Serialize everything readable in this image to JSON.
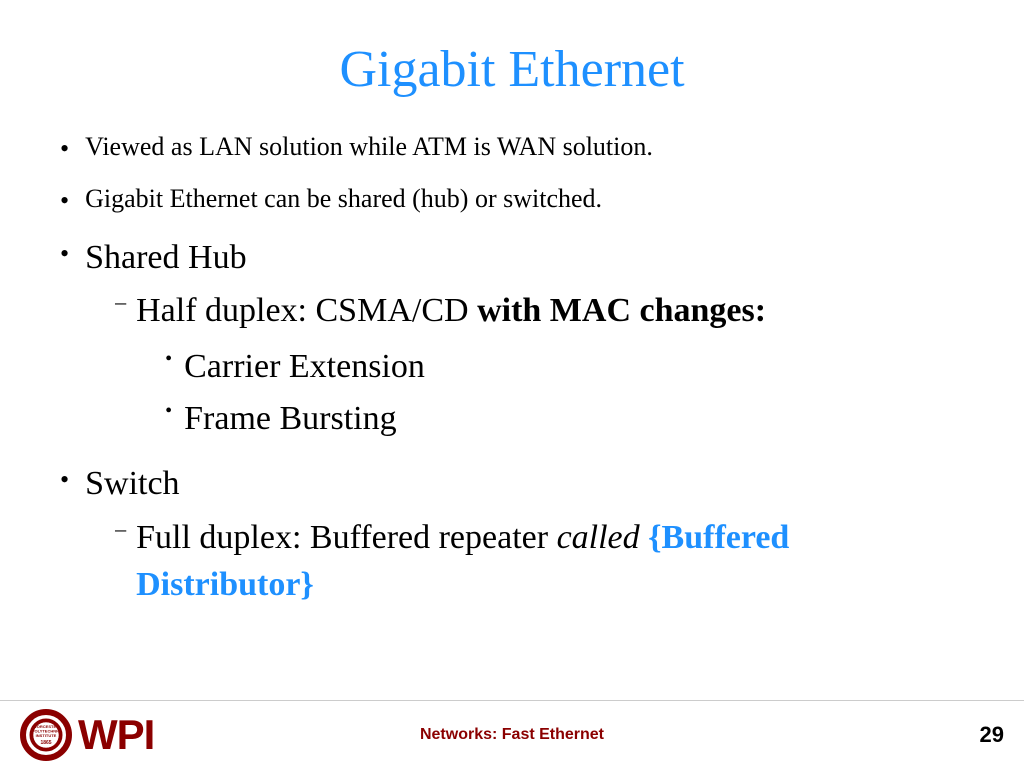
{
  "slide": {
    "title": "Gigabit Ethernet",
    "bullets": [
      {
        "id": "bullet1",
        "text": "Viewed as LAN solution while ATM is WAN solution.",
        "level": 1,
        "large": false
      },
      {
        "id": "bullet2",
        "text": "Gigabit Ethernet can be shared (hub) or switched.",
        "level": 1,
        "large": false
      },
      {
        "id": "bullet3",
        "text": "Shared Hub",
        "level": 1,
        "large": true,
        "children": [
          {
            "id": "bullet3-1",
            "text_plain": "Half duplex: CSMA/CD ",
            "text_bold": "with MAC changes:",
            "level": 2,
            "children": [
              {
                "id": "bullet3-1-1",
                "text": "Carrier Extension",
                "level": 3
              },
              {
                "id": "bullet3-1-2",
                "text": "Frame Bursting",
                "level": 3
              }
            ]
          }
        ]
      },
      {
        "id": "bullet4",
        "text": "Switch",
        "level": 1,
        "large": true,
        "children": [
          {
            "id": "bullet4-1",
            "text_plain": "Full duplex: Buffered repeater ",
            "text_italic": "called ",
            "text_cyan": "{Buffered Distributor}",
            "level": 2
          }
        ]
      }
    ]
  },
  "footer": {
    "course": "Networks: Fast Ethernet",
    "page": "29",
    "logo_text": "WPI"
  }
}
